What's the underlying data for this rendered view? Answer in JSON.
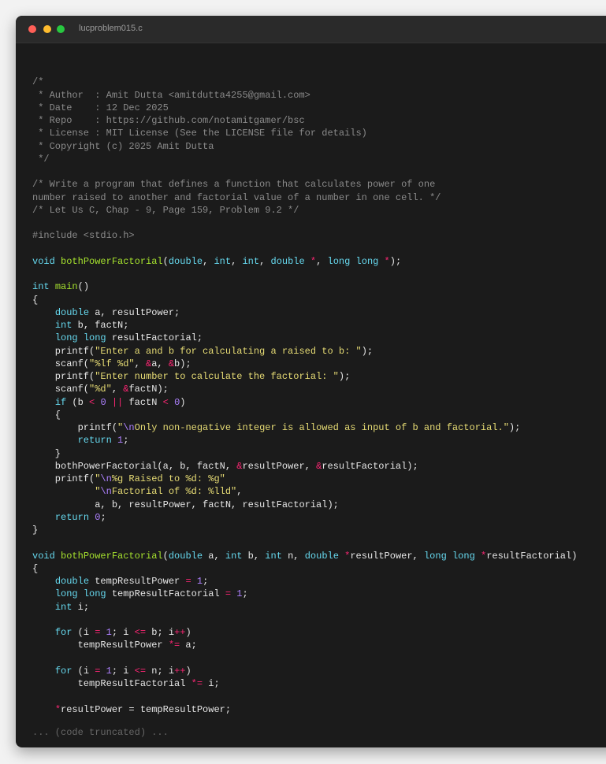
{
  "window": {
    "filename": "lucproblem015.c",
    "truncated_note": "... (code truncated) ..."
  },
  "colors": {
    "background": "#1b1b1b",
    "comment": "#8a8a8a",
    "keyword": "#66d9ef",
    "function": "#a6e22e",
    "string": "#e6db74",
    "operator": "#f92672",
    "number": "#ae81ff",
    "plain": "#e6e6e6"
  },
  "code_lines": [
    [],
    [
      {
        "t": "/*",
        "c": "cm"
      }
    ],
    [
      {
        "t": " * Author  : Amit Dutta <amitdutta4255@gmail.com>",
        "c": "cm"
      }
    ],
    [
      {
        "t": " * Date    : 12 Dec 2025",
        "c": "cm"
      }
    ],
    [
      {
        "t": " * Repo    : https://github.com/notamitgamer/bsc",
        "c": "cm"
      }
    ],
    [
      {
        "t": " * License : MIT License (See the LICENSE file for details)",
        "c": "cm"
      }
    ],
    [
      {
        "t": " * Copyright (c) 2025 Amit Dutta",
        "c": "cm"
      }
    ],
    [
      {
        "t": " */",
        "c": "cm"
      }
    ],
    [],
    [
      {
        "t": "/* Write a program that defines a function that calculates power of one",
        "c": "cm"
      }
    ],
    [
      {
        "t": "number raised to another and factorial value of a number in one cell. */",
        "c": "cm"
      }
    ],
    [
      {
        "t": "/* Let Us C, Chap - 9, Page 159, Problem 9.2 */",
        "c": "cm"
      }
    ],
    [],
    [
      {
        "t": "#include <stdio.h>",
        "c": "pp"
      }
    ],
    [],
    [
      {
        "t": "void",
        "c": "kw"
      },
      {
        "t": " ",
        "c": "pl"
      },
      {
        "t": "bothPowerFactorial",
        "c": "fn"
      },
      {
        "t": "(",
        "c": "pl"
      },
      {
        "t": "double",
        "c": "kw"
      },
      {
        "t": ", ",
        "c": "pl"
      },
      {
        "t": "int",
        "c": "kw"
      },
      {
        "t": ", ",
        "c": "pl"
      },
      {
        "t": "int",
        "c": "kw"
      },
      {
        "t": ", ",
        "c": "pl"
      },
      {
        "t": "double",
        "c": "kw"
      },
      {
        "t": " ",
        "c": "pl"
      },
      {
        "t": "*",
        "c": "op"
      },
      {
        "t": ", ",
        "c": "pl"
      },
      {
        "t": "long long",
        "c": "kw"
      },
      {
        "t": " ",
        "c": "pl"
      },
      {
        "t": "*",
        "c": "op"
      },
      {
        "t": ");",
        "c": "pl"
      }
    ],
    [],
    [
      {
        "t": "int",
        "c": "kw"
      },
      {
        "t": " ",
        "c": "pl"
      },
      {
        "t": "main",
        "c": "fn"
      },
      {
        "t": "()",
        "c": "pl"
      }
    ],
    [
      {
        "t": "{",
        "c": "pl"
      }
    ],
    [
      {
        "t": "    ",
        "c": "pl"
      },
      {
        "t": "double",
        "c": "kw"
      },
      {
        "t": " a, resultPower;",
        "c": "pl"
      }
    ],
    [
      {
        "t": "    ",
        "c": "pl"
      },
      {
        "t": "int",
        "c": "kw"
      },
      {
        "t": " b, factN;",
        "c": "pl"
      }
    ],
    [
      {
        "t": "    ",
        "c": "pl"
      },
      {
        "t": "long long",
        "c": "kw"
      },
      {
        "t": " resultFactorial;",
        "c": "pl"
      }
    ],
    [
      {
        "t": "    printf(",
        "c": "pl"
      },
      {
        "t": "\"Enter a and b for calculating a raised to b: \"",
        "c": "st"
      },
      {
        "t": ");",
        "c": "pl"
      }
    ],
    [
      {
        "t": "    scanf(",
        "c": "pl"
      },
      {
        "t": "\"%lf %d\"",
        "c": "st"
      },
      {
        "t": ", ",
        "c": "pl"
      },
      {
        "t": "&",
        "c": "op"
      },
      {
        "t": "a, ",
        "c": "pl"
      },
      {
        "t": "&",
        "c": "op"
      },
      {
        "t": "b);",
        "c": "pl"
      }
    ],
    [
      {
        "t": "    printf(",
        "c": "pl"
      },
      {
        "t": "\"Enter number to calculate the factorial: \"",
        "c": "st"
      },
      {
        "t": ");",
        "c": "pl"
      }
    ],
    [
      {
        "t": "    scanf(",
        "c": "pl"
      },
      {
        "t": "\"%d\"",
        "c": "st"
      },
      {
        "t": ", ",
        "c": "pl"
      },
      {
        "t": "&",
        "c": "op"
      },
      {
        "t": "factN);",
        "c": "pl"
      }
    ],
    [
      {
        "t": "    ",
        "c": "pl"
      },
      {
        "t": "if",
        "c": "kw"
      },
      {
        "t": " (b ",
        "c": "pl"
      },
      {
        "t": "<",
        "c": "op"
      },
      {
        "t": " ",
        "c": "pl"
      },
      {
        "t": "0",
        "c": "nu"
      },
      {
        "t": " ",
        "c": "pl"
      },
      {
        "t": "||",
        "c": "op"
      },
      {
        "t": " factN ",
        "c": "pl"
      },
      {
        "t": "<",
        "c": "op"
      },
      {
        "t": " ",
        "c": "pl"
      },
      {
        "t": "0",
        "c": "nu"
      },
      {
        "t": ")",
        "c": "pl"
      }
    ],
    [
      {
        "t": "    {",
        "c": "pl"
      }
    ],
    [
      {
        "t": "        printf(",
        "c": "pl"
      },
      {
        "t": "\"",
        "c": "st"
      },
      {
        "t": "\\n",
        "c": "nu"
      },
      {
        "t": "Only non-negative integer is allowed as input of b and factorial.\"",
        "c": "st"
      },
      {
        "t": ");",
        "c": "pl"
      }
    ],
    [
      {
        "t": "        ",
        "c": "pl"
      },
      {
        "t": "return",
        "c": "kw"
      },
      {
        "t": " ",
        "c": "pl"
      },
      {
        "t": "1",
        "c": "nu"
      },
      {
        "t": ";",
        "c": "pl"
      }
    ],
    [
      {
        "t": "    }",
        "c": "pl"
      }
    ],
    [
      {
        "t": "    bothPowerFactorial(a, b, factN, ",
        "c": "pl"
      },
      {
        "t": "&",
        "c": "op"
      },
      {
        "t": "resultPower, ",
        "c": "pl"
      },
      {
        "t": "&",
        "c": "op"
      },
      {
        "t": "resultFactorial);",
        "c": "pl"
      }
    ],
    [
      {
        "t": "    printf(",
        "c": "pl"
      },
      {
        "t": "\"",
        "c": "st"
      },
      {
        "t": "\\n",
        "c": "nu"
      },
      {
        "t": "%g Raised to %d: %g\"",
        "c": "st"
      }
    ],
    [
      {
        "t": "           ",
        "c": "pl"
      },
      {
        "t": "\"",
        "c": "st"
      },
      {
        "t": "\\n",
        "c": "nu"
      },
      {
        "t": "Factorial of %d: %lld\"",
        "c": "st"
      },
      {
        "t": ",",
        "c": "pl"
      }
    ],
    [
      {
        "t": "           a, b, resultPower, factN, resultFactorial);",
        "c": "pl"
      }
    ],
    [
      {
        "t": "    ",
        "c": "pl"
      },
      {
        "t": "return",
        "c": "kw"
      },
      {
        "t": " ",
        "c": "pl"
      },
      {
        "t": "0",
        "c": "nu"
      },
      {
        "t": ";",
        "c": "pl"
      }
    ],
    [
      {
        "t": "}",
        "c": "pl"
      }
    ],
    [],
    [
      {
        "t": "void",
        "c": "kw"
      },
      {
        "t": " ",
        "c": "pl"
      },
      {
        "t": "bothPowerFactorial",
        "c": "fn"
      },
      {
        "t": "(",
        "c": "pl"
      },
      {
        "t": "double",
        "c": "kw"
      },
      {
        "t": " a, ",
        "c": "pl"
      },
      {
        "t": "int",
        "c": "kw"
      },
      {
        "t": " b, ",
        "c": "pl"
      },
      {
        "t": "int",
        "c": "kw"
      },
      {
        "t": " n, ",
        "c": "pl"
      },
      {
        "t": "double",
        "c": "kw"
      },
      {
        "t": " ",
        "c": "pl"
      },
      {
        "t": "*",
        "c": "op"
      },
      {
        "t": "resultPower, ",
        "c": "pl"
      },
      {
        "t": "long long",
        "c": "kw"
      },
      {
        "t": " ",
        "c": "pl"
      },
      {
        "t": "*",
        "c": "op"
      },
      {
        "t": "resultFactorial)",
        "c": "pl"
      }
    ],
    [
      {
        "t": "{",
        "c": "pl"
      }
    ],
    [
      {
        "t": "    ",
        "c": "pl"
      },
      {
        "t": "double",
        "c": "kw"
      },
      {
        "t": " tempResultPower ",
        "c": "pl"
      },
      {
        "t": "=",
        "c": "op"
      },
      {
        "t": " ",
        "c": "pl"
      },
      {
        "t": "1",
        "c": "nu"
      },
      {
        "t": ";",
        "c": "pl"
      }
    ],
    [
      {
        "t": "    ",
        "c": "pl"
      },
      {
        "t": "long long",
        "c": "kw"
      },
      {
        "t": " tempResultFactorial ",
        "c": "pl"
      },
      {
        "t": "=",
        "c": "op"
      },
      {
        "t": " ",
        "c": "pl"
      },
      {
        "t": "1",
        "c": "nu"
      },
      {
        "t": ";",
        "c": "pl"
      }
    ],
    [
      {
        "t": "    ",
        "c": "pl"
      },
      {
        "t": "int",
        "c": "kw"
      },
      {
        "t": " i;",
        "c": "pl"
      }
    ],
    [],
    [
      {
        "t": "    ",
        "c": "pl"
      },
      {
        "t": "for",
        "c": "kw"
      },
      {
        "t": " (i ",
        "c": "pl"
      },
      {
        "t": "=",
        "c": "op"
      },
      {
        "t": " ",
        "c": "pl"
      },
      {
        "t": "1",
        "c": "nu"
      },
      {
        "t": "; i ",
        "c": "pl"
      },
      {
        "t": "<=",
        "c": "op"
      },
      {
        "t": " b; i",
        "c": "pl"
      },
      {
        "t": "++",
        "c": "op"
      },
      {
        "t": ")",
        "c": "pl"
      }
    ],
    [
      {
        "t": "        tempResultPower ",
        "c": "pl"
      },
      {
        "t": "*=",
        "c": "op"
      },
      {
        "t": " a;",
        "c": "pl"
      }
    ],
    [],
    [
      {
        "t": "    ",
        "c": "pl"
      },
      {
        "t": "for",
        "c": "kw"
      },
      {
        "t": " (i ",
        "c": "pl"
      },
      {
        "t": "=",
        "c": "op"
      },
      {
        "t": " ",
        "c": "pl"
      },
      {
        "t": "1",
        "c": "nu"
      },
      {
        "t": "; i ",
        "c": "pl"
      },
      {
        "t": "<=",
        "c": "op"
      },
      {
        "t": " n; i",
        "c": "pl"
      },
      {
        "t": "++",
        "c": "op"
      },
      {
        "t": ")",
        "c": "pl"
      }
    ],
    [
      {
        "t": "        tempResultFactorial ",
        "c": "pl"
      },
      {
        "t": "*=",
        "c": "op"
      },
      {
        "t": " i;",
        "c": "pl"
      }
    ],
    [],
    [
      {
        "t": "    ",
        "c": "pl"
      },
      {
        "t": "*",
        "c": "op"
      },
      {
        "t": "resultPower = tempResultPower;",
        "c": "pl"
      }
    ]
  ]
}
